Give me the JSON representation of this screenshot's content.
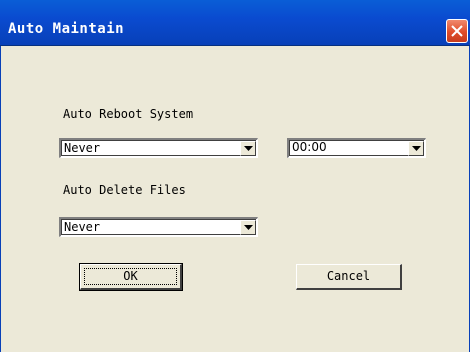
{
  "window": {
    "title": "Auto Maintain",
    "close_icon": "close-icon"
  },
  "reboot": {
    "label": "Auto Reboot System",
    "frequency_value": "Never",
    "time_value": "00:00"
  },
  "delete": {
    "label": "Auto Delete Files",
    "value": "Never"
  },
  "buttons": {
    "ok_label": "OK",
    "cancel_label": "Cancel"
  },
  "colors": {
    "titlebar": "#0a4bd0",
    "dialog_bg": "#ece9d8",
    "close_button": "#e04d2a"
  }
}
